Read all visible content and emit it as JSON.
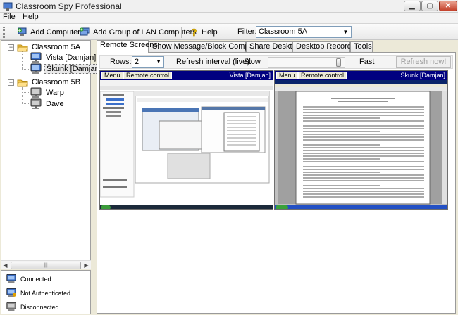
{
  "window": {
    "title": "Classroom Spy Professional"
  },
  "menu": {
    "file": "File",
    "help": "Help"
  },
  "toolbar": {
    "add_computer": "Add Computer",
    "add_group": "Add Group of LAN Computers",
    "help": "Help",
    "filter_label": "Filter:",
    "filter_value": "Classroom 5A"
  },
  "tree": [
    {
      "label": "Classroom 5A",
      "type": "group"
    },
    {
      "label": "Vista [Damjan]",
      "type": "computer"
    },
    {
      "label": "Skunk [Damjan]",
      "type": "computer",
      "selected": true
    },
    {
      "label": "Classroom 5B",
      "type": "group"
    },
    {
      "label": "Warp",
      "type": "computer"
    },
    {
      "label": "Dave",
      "type": "computer"
    }
  ],
  "legend": {
    "connected": "Connected",
    "not_authenticated": "Not Authenticated",
    "disconnected": "Disconnected"
  },
  "tabs": [
    "Remote Screens",
    "Show Message/Block Computers",
    "Share Desktop",
    "Desktop Recorder",
    "Tools"
  ],
  "active_tab": "Remote Screens",
  "controls": {
    "rows_label": "Rows:",
    "rows_value": "2",
    "refresh_label": "Refresh interval (live):",
    "slow": "Slow",
    "fast": "Fast",
    "refresh_now": "Refresh now!",
    "refresh_interval_level": 0.95
  },
  "screens": [
    {
      "menu": "Menu",
      "remote": "Remote control",
      "title": "Vista [Damjan]"
    },
    {
      "menu": "Menu",
      "remote": "Remote control",
      "title": "Skunk [Damjan]"
    }
  ],
  "colors": {
    "accent": "#000080",
    "folder": "#f2c94c",
    "taskbar_blue": "#2350c4",
    "vista_taskbar": "#1b2a3a"
  }
}
